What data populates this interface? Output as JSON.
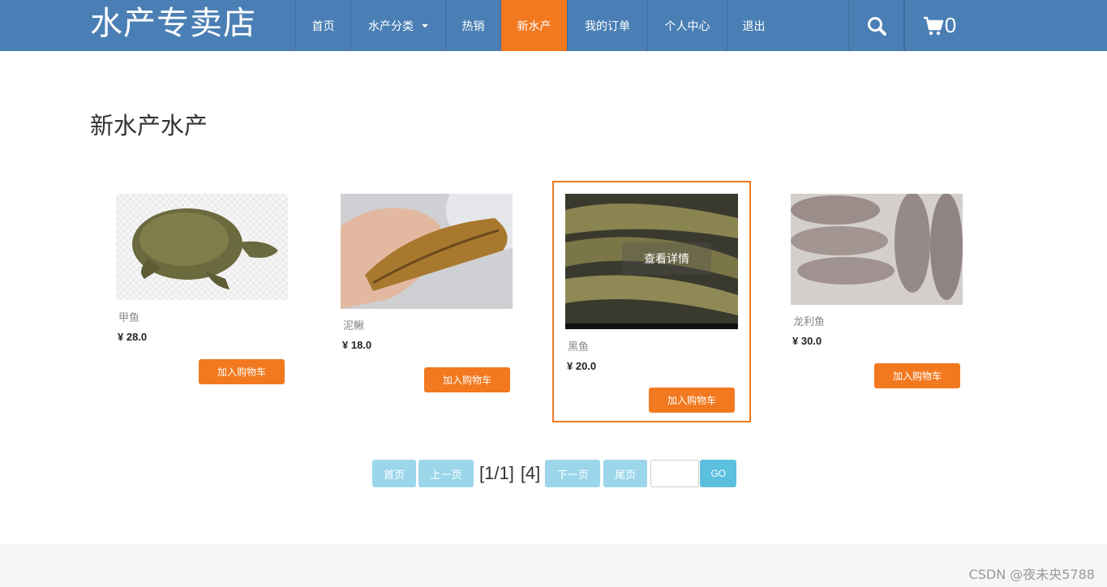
{
  "header": {
    "brand": "水产专卖店",
    "nav": [
      {
        "label": "首页"
      },
      {
        "label": "水产分类"
      },
      {
        "label": "热销"
      },
      {
        "label": "新水产"
      },
      {
        "label": "我的订单"
      },
      {
        "label": "个人中心"
      },
      {
        "label": "退出"
      }
    ],
    "cart_count": "0",
    "active_color": "#f2791f",
    "bar_color": "#4a7fb5"
  },
  "page": {
    "title": "新水产水产"
  },
  "products": [
    {
      "name": "甲鱼",
      "price": "¥ 28.0",
      "button": "加入购物车"
    },
    {
      "name": "泥鳅",
      "price": "¥ 18.0",
      "button": "加入购物车"
    },
    {
      "name": "黑鱼",
      "price": "¥ 20.0",
      "button": "加入购物车",
      "overlay": "查看详情"
    },
    {
      "name": "龙利鱼",
      "price": "¥ 30.0",
      "button": "加入购物车"
    }
  ],
  "pager": {
    "first": "首页",
    "prev": "上一页",
    "page_info": "[1/1]",
    "count_info": "[4]",
    "next": "下一页",
    "last": "尾页",
    "go": "GO"
  },
  "watermark": "CSDN @夜未央5788"
}
